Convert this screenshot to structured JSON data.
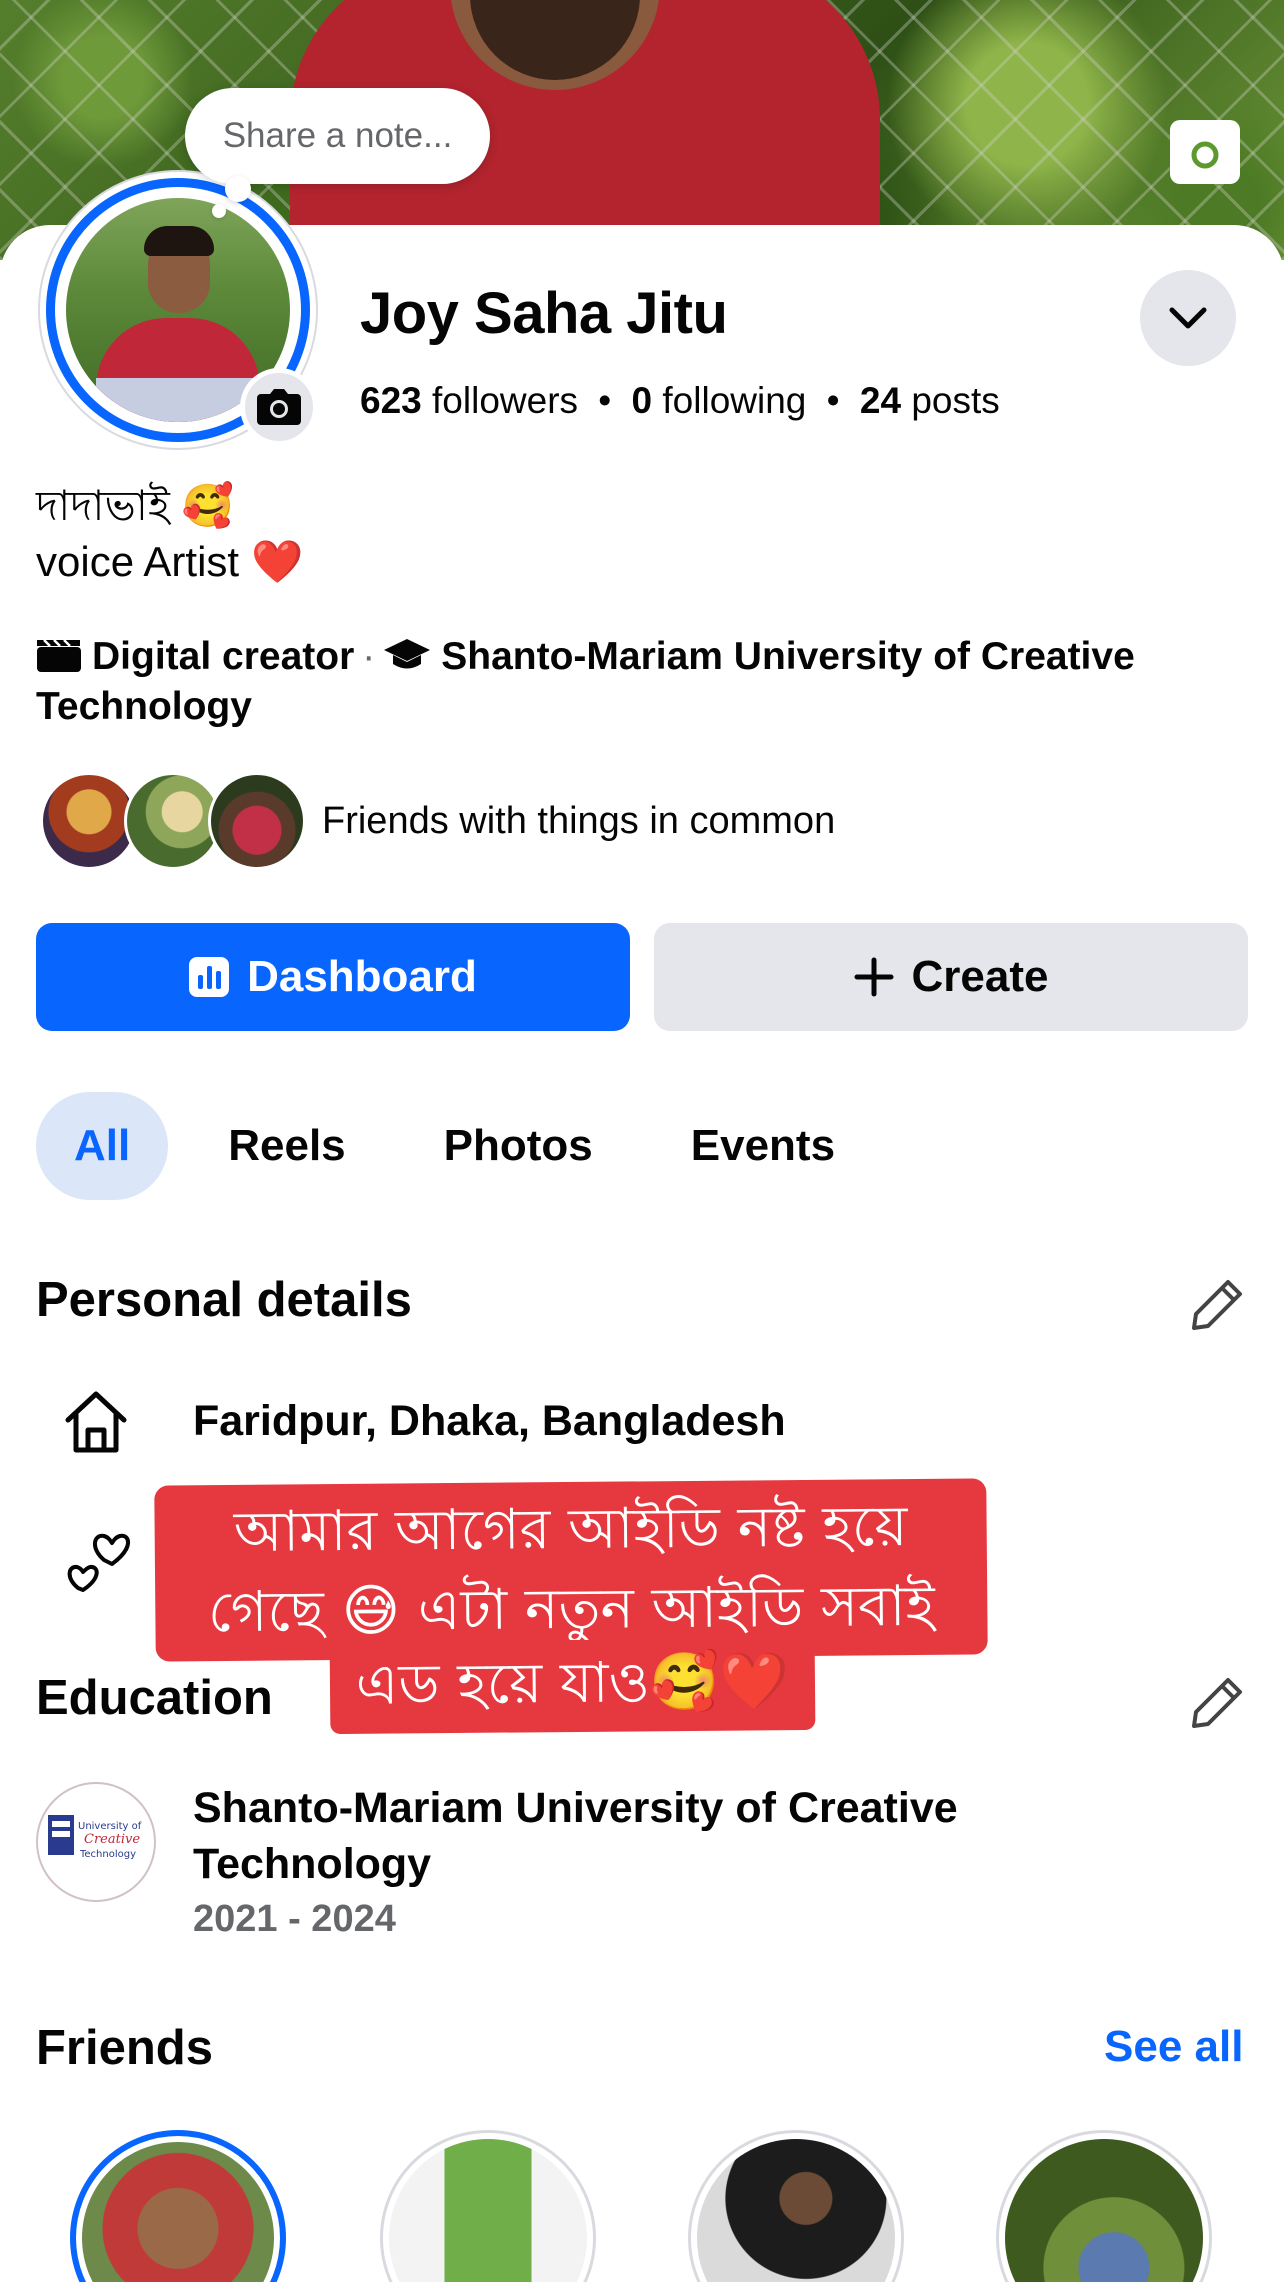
{
  "note": {
    "placeholder": "Share a note..."
  },
  "profile": {
    "name": "Joy Saha Jitu",
    "followers_count": "623",
    "followers_label": "followers",
    "following_count": "0",
    "following_label": "following",
    "posts_count": "24",
    "posts_label": "posts",
    "separator": "•"
  },
  "bio": {
    "line1": "দাদাভাই",
    "line1_emoji": "🥰",
    "line2": "voice Artist",
    "line2_emoji": "❤️"
  },
  "info": {
    "category": "Digital creator",
    "separator": "·",
    "school": "Shanto-Mariam University of Creative Technology"
  },
  "friends_common": {
    "text": "Friends with things in common"
  },
  "actions": {
    "dashboard_label": "Dashboard",
    "create_label": "Create"
  },
  "tabs": [
    {
      "label": "All",
      "active": true
    },
    {
      "label": "Reels",
      "active": false
    },
    {
      "label": "Photos",
      "active": false
    },
    {
      "label": "Events",
      "active": false
    }
  ],
  "personal_details": {
    "title": "Personal details",
    "location": "Faridpur, Dhaka, Bangladesh"
  },
  "sticker": {
    "line1": "আমার আগের আইডি নষ্ট হয়ে",
    "line2": "গেছে 😅 এটা নতুন আইডি সবাই",
    "line3": "এড হয়ে যাও🥰❤️"
  },
  "education": {
    "title": "Education",
    "school": "Shanto-Mariam University of Creative Technology",
    "years": "2021 - 2024",
    "logo_text_1": "University of",
    "logo_text_2": "Creative",
    "logo_text_3": "Technology"
  },
  "friends": {
    "title": "Friends",
    "see_all": "See all"
  },
  "colors": {
    "accent": "#0866ff",
    "sticker": "#e5393f",
    "button_gray": "#e4e6eb",
    "tab_active_bg": "#dbe7f8"
  },
  "icons": [
    "camera-icon",
    "chevron-down-icon",
    "clapperboard-icon",
    "graduation-cap-icon",
    "dashboard-icon",
    "plus-icon",
    "pencil-icon",
    "home-icon",
    "hearts-icon"
  ]
}
